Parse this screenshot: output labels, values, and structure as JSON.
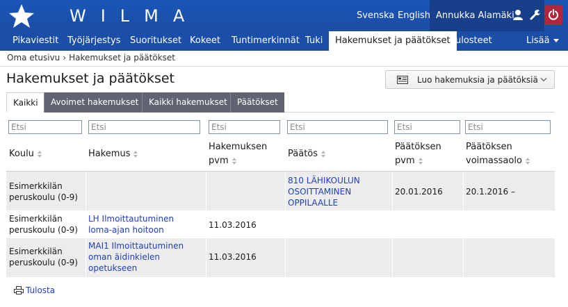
{
  "header": {
    "brand": "WILMA",
    "languages": [
      "Svenska",
      "English"
    ],
    "user_name": "Annukka Alamäki"
  },
  "nav": {
    "items": [
      "Pikaviestit",
      "Työjärjestys",
      "Suoritukset",
      "Kokeet",
      "Tuntimerkinnät",
      "Tuki",
      "Hakemukset ja päätökset",
      "Tulosteet"
    ],
    "active_index": 6,
    "more_label": "Lisää"
  },
  "breadcrumb": [
    "Oma etusivu",
    "Hakemukset ja päätökset"
  ],
  "page": {
    "title": "Hakemukset ja päätökset",
    "create_button": "Luo hakemuksia ja päätöksiä"
  },
  "tabs": [
    "Kaikki",
    "Avoimet hakemukset",
    "Kaikki hakemukset",
    "Päätökset"
  ],
  "filters": {
    "placeholder": "Etsi"
  },
  "table": {
    "columns": [
      [
        "Koulu"
      ],
      [
        "Hakemus"
      ],
      [
        "Hakemuksen",
        "pvm"
      ],
      [
        "Päätös"
      ],
      [
        "Päätöksen",
        "pvm"
      ],
      [
        "Päätöksen",
        "voimassaolo"
      ]
    ],
    "rows": [
      {
        "koulu": [
          "Esimerkkilän",
          "peruskoulu (0-9)"
        ],
        "hakemus": [],
        "hakemus_pvm": "",
        "paatos": [
          "810 LÄHIKOULUN",
          "OSOITTAMINEN",
          "OPPILAALLE"
        ],
        "paatos_pvm": "20.01.2016",
        "voimassaolo": "20.1.2016 –"
      },
      {
        "koulu": [
          "Esimerkkilän",
          "peruskoulu (0-9)"
        ],
        "hakemus": [
          "LH Ilmoittautuminen",
          "loma-ajan hoitoon"
        ],
        "hakemus_pvm": "11.03.2016",
        "paatos": [],
        "paatos_pvm": "",
        "voimassaolo": ""
      },
      {
        "koulu": [
          "Esimerkkilän",
          "peruskoulu (0-9)"
        ],
        "hakemus": [
          "MAI1 Ilmoittautuminen",
          "oman äidinkielen",
          "opetukseen"
        ],
        "hakemus_pvm": "11.03.2016",
        "paatos": [],
        "paatos_pvm": "",
        "voimassaolo": ""
      }
    ]
  },
  "footer": {
    "print_label": "Tulosta"
  },
  "colors": {
    "header_blue": "#1b4ea6",
    "user_box": "#183f8a",
    "logout_red": "#b0263b",
    "tab_gray": "#606470",
    "link_blue": "#1f3fba",
    "row_gray": "#ececec"
  }
}
